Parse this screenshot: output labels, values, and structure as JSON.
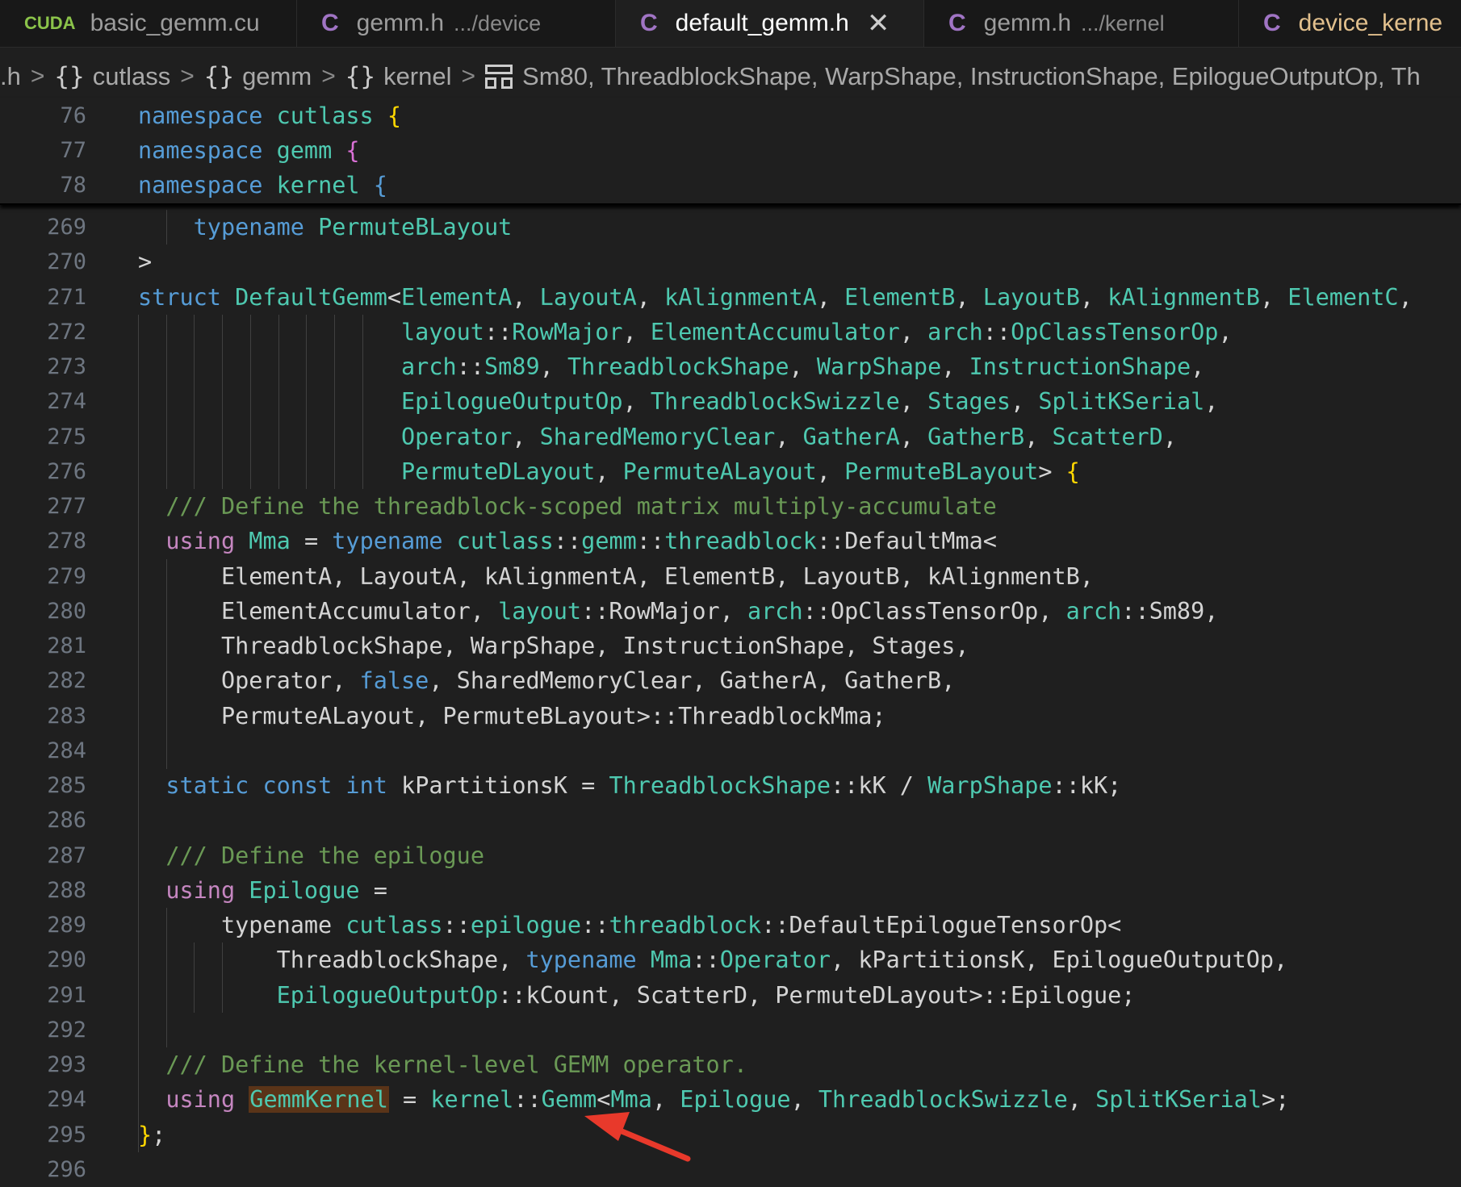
{
  "tabs": [
    {
      "name": "basic_gemm.cu",
      "icon": "cuda-file-icon",
      "icon_text": "CUDA",
      "desc": "",
      "active": false
    },
    {
      "name": "gemm.h",
      "icon": "c-file-icon",
      "icon_text": "C",
      "desc": ".../device",
      "active": false
    },
    {
      "name": "default_gemm.h",
      "icon": "c-file-icon",
      "icon_text": "C",
      "desc": "",
      "active": true
    },
    {
      "name": "gemm.h",
      "icon": "c-file-icon",
      "icon_text": "C",
      "desc": ".../kernel",
      "active": false
    },
    {
      "name": "device_kerne",
      "icon": "c-file-icon",
      "icon_text": "C",
      "desc": "",
      "active": false
    }
  ],
  "tab_close_glyph": "✕",
  "breadcrumb": {
    "items": [
      {
        "label": ".h",
        "icon": ""
      },
      {
        "label": "cutlass",
        "icon": "{}"
      },
      {
        "label": "gemm",
        "icon": "{}"
      },
      {
        "label": "kernel",
        "icon": "{}"
      },
      {
        "label": "Sm80, ThreadblockShape, WarpShape, InstructionShape, EpilogueOutputOp, Th",
        "icon": "struct"
      }
    ],
    "separator": ">"
  },
  "sticky_lines": [
    {
      "n": "76",
      "tokens": [
        [
          "k",
          "namespace"
        ],
        [
          "w",
          " "
        ],
        [
          "t",
          "cutlass"
        ],
        [
          "w",
          " "
        ],
        [
          "y",
          "{"
        ]
      ]
    },
    {
      "n": "77",
      "tokens": [
        [
          "k",
          "namespace"
        ],
        [
          "w",
          " "
        ],
        [
          "t",
          "gemm"
        ],
        [
          "w",
          " "
        ],
        [
          "pb",
          "{"
        ]
      ]
    },
    {
      "n": "78",
      "tokens": [
        [
          "k",
          "namespace"
        ],
        [
          "w",
          " "
        ],
        [
          "t",
          "kernel"
        ],
        [
          "w",
          " "
        ],
        [
          "k",
          "{"
        ]
      ]
    }
  ],
  "lines": [
    {
      "n": "269",
      "indent": "    ",
      "tokens": [
        [
          "k",
          "typename"
        ],
        [
          "w",
          " "
        ],
        [
          "t",
          "PermuteBLayout"
        ]
      ]
    },
    {
      "n": "270",
      "indent": "",
      "tokens": [
        [
          "w",
          ">"
        ]
      ]
    },
    {
      "n": "271",
      "indent": "",
      "tokens": [
        [
          "k",
          "struct"
        ],
        [
          "w",
          " "
        ],
        [
          "t",
          "DefaultGemm"
        ],
        [
          "w",
          "<"
        ],
        [
          "t",
          "ElementA"
        ],
        [
          "w",
          ", "
        ],
        [
          "t",
          "LayoutA"
        ],
        [
          "w",
          ", "
        ],
        [
          "t",
          "kAlignmentA"
        ],
        [
          "w",
          ", "
        ],
        [
          "t",
          "ElementB"
        ],
        [
          "w",
          ", "
        ],
        [
          "t",
          "LayoutB"
        ],
        [
          "w",
          ", "
        ],
        [
          "t",
          "kAlignmentB"
        ],
        [
          "w",
          ", "
        ],
        [
          "t",
          "ElementC"
        ],
        [
          "w",
          ","
        ]
      ]
    },
    {
      "n": "272",
      "indent": "                   ",
      "tokens": [
        [
          "t",
          "layout"
        ],
        [
          "w",
          "::"
        ],
        [
          "t",
          "RowMajor"
        ],
        [
          "w",
          ", "
        ],
        [
          "t",
          "ElementAccumulator"
        ],
        [
          "w",
          ", "
        ],
        [
          "t",
          "arch"
        ],
        [
          "w",
          "::"
        ],
        [
          "t",
          "OpClassTensorOp"
        ],
        [
          "w",
          ","
        ]
      ]
    },
    {
      "n": "273",
      "indent": "                   ",
      "tokens": [
        [
          "t",
          "arch"
        ],
        [
          "w",
          "::"
        ],
        [
          "t",
          "Sm89"
        ],
        [
          "w",
          ", "
        ],
        [
          "t",
          "ThreadblockShape"
        ],
        [
          "w",
          ", "
        ],
        [
          "t",
          "WarpShape"
        ],
        [
          "w",
          ", "
        ],
        [
          "t",
          "InstructionShape"
        ],
        [
          "w",
          ","
        ]
      ]
    },
    {
      "n": "274",
      "indent": "                   ",
      "tokens": [
        [
          "t",
          "EpilogueOutputOp"
        ],
        [
          "w",
          ", "
        ],
        [
          "t",
          "ThreadblockSwizzle"
        ],
        [
          "w",
          ", "
        ],
        [
          "t",
          "Stages"
        ],
        [
          "w",
          ", "
        ],
        [
          "t",
          "SplitKSerial"
        ],
        [
          "w",
          ","
        ]
      ]
    },
    {
      "n": "275",
      "indent": "                   ",
      "tokens": [
        [
          "t",
          "Operator"
        ],
        [
          "w",
          ", "
        ],
        [
          "t",
          "SharedMemoryClear"
        ],
        [
          "w",
          ", "
        ],
        [
          "t",
          "GatherA"
        ],
        [
          "w",
          ", "
        ],
        [
          "t",
          "GatherB"
        ],
        [
          "w",
          ", "
        ],
        [
          "t",
          "ScatterD"
        ],
        [
          "w",
          ","
        ]
      ]
    },
    {
      "n": "276",
      "indent": "                   ",
      "tokens": [
        [
          "t",
          "PermuteDLayout"
        ],
        [
          "w",
          ", "
        ],
        [
          "t",
          "PermuteALayout"
        ],
        [
          "w",
          ", "
        ],
        [
          "t",
          "PermuteBLayout"
        ],
        [
          "w",
          "> "
        ],
        [
          "y",
          "{"
        ]
      ]
    },
    {
      "n": "277",
      "indent": "  ",
      "tokens": [
        [
          "cm",
          "/// Define the threadblock-scoped matrix multiply-accumulate"
        ]
      ]
    },
    {
      "n": "278",
      "indent": "  ",
      "tokens": [
        [
          "p",
          "using"
        ],
        [
          "w",
          " "
        ],
        [
          "t",
          "Mma"
        ],
        [
          "w",
          " = "
        ],
        [
          "k",
          "typename"
        ],
        [
          "w",
          " "
        ],
        [
          "t",
          "cutlass"
        ],
        [
          "w",
          "::"
        ],
        [
          "t",
          "gemm"
        ],
        [
          "w",
          "::"
        ],
        [
          "t",
          "threadblock"
        ],
        [
          "w",
          "::DefaultMma<"
        ]
      ]
    },
    {
      "n": "279",
      "indent": "      ",
      "tokens": [
        [
          "w",
          "ElementA, LayoutA, kAlignmentA, ElementB, LayoutB, kAlignmentB,"
        ]
      ]
    },
    {
      "n": "280",
      "indent": "      ",
      "tokens": [
        [
          "w",
          "ElementAccumulator, "
        ],
        [
          "t",
          "layout"
        ],
        [
          "w",
          "::RowMajor, "
        ],
        [
          "t",
          "arch"
        ],
        [
          "w",
          "::OpClassTensorOp, "
        ],
        [
          "t",
          "arch"
        ],
        [
          "w",
          "::Sm89,"
        ]
      ]
    },
    {
      "n": "281",
      "indent": "      ",
      "tokens": [
        [
          "w",
          "ThreadblockShape, WarpShape, InstructionShape, Stages,"
        ]
      ]
    },
    {
      "n": "282",
      "indent": "      ",
      "tokens": [
        [
          "w",
          "Operator, "
        ],
        [
          "k",
          "false"
        ],
        [
          "w",
          ", SharedMemoryClear, GatherA, GatherB,"
        ]
      ]
    },
    {
      "n": "283",
      "indent": "      ",
      "tokens": [
        [
          "w",
          "PermuteALayout, PermuteBLayout>::ThreadblockMma;"
        ]
      ]
    },
    {
      "n": "284",
      "indent": "",
      "tokens": []
    },
    {
      "n": "285",
      "indent": "  ",
      "tokens": [
        [
          "k",
          "static"
        ],
        [
          "w",
          " "
        ],
        [
          "k",
          "const"
        ],
        [
          "w",
          " "
        ],
        [
          "k",
          "int"
        ],
        [
          "w",
          " kPartitionsK = "
        ],
        [
          "t",
          "ThreadblockShape"
        ],
        [
          "w",
          "::kK / "
        ],
        [
          "t",
          "WarpShape"
        ],
        [
          "w",
          "::kK;"
        ]
      ]
    },
    {
      "n": "286",
      "indent": "",
      "tokens": []
    },
    {
      "n": "287",
      "indent": "  ",
      "tokens": [
        [
          "cm",
          "/// Define the epilogue"
        ]
      ]
    },
    {
      "n": "288",
      "indent": "  ",
      "tokens": [
        [
          "p",
          "using"
        ],
        [
          "w",
          " "
        ],
        [
          "t",
          "Epilogue"
        ],
        [
          "w",
          " ="
        ]
      ]
    },
    {
      "n": "289",
      "indent": "      ",
      "tokens": [
        [
          "w",
          "typename "
        ],
        [
          "t",
          "cutlass"
        ],
        [
          "w",
          "::"
        ],
        [
          "t",
          "epilogue"
        ],
        [
          "w",
          "::"
        ],
        [
          "t",
          "threadblock"
        ],
        [
          "w",
          "::DefaultEpilogueTensorOp<"
        ]
      ]
    },
    {
      "n": "290",
      "indent": "          ",
      "tokens": [
        [
          "w",
          "ThreadblockShape, "
        ],
        [
          "k",
          "typename"
        ],
        [
          "w",
          " "
        ],
        [
          "t",
          "Mma"
        ],
        [
          "w",
          "::"
        ],
        [
          "t",
          "Operator"
        ],
        [
          "w",
          ", kPartitionsK, EpilogueOutputOp,"
        ]
      ]
    },
    {
      "n": "291",
      "indent": "          ",
      "tokens": [
        [
          "t",
          "EpilogueOutputOp"
        ],
        [
          "w",
          "::kCount, ScatterD, PermuteDLayout>::Epilogue;"
        ]
      ]
    },
    {
      "n": "292",
      "indent": "",
      "tokens": []
    },
    {
      "n": "293",
      "indent": "  ",
      "tokens": [
        [
          "cm",
          "/// Define the kernel-level GEMM operator."
        ]
      ]
    },
    {
      "n": "294",
      "indent": "  ",
      "tokens": [
        [
          "p",
          "using"
        ],
        [
          "w",
          " "
        ],
        [
          "hl",
          "GemmKernel"
        ],
        [
          "w",
          " = "
        ],
        [
          "t",
          "kernel"
        ],
        [
          "w",
          "::"
        ],
        [
          "t",
          "Gemm"
        ],
        [
          "w",
          "<"
        ],
        [
          "t",
          "Mma"
        ],
        [
          "w",
          ", "
        ],
        [
          "t",
          "Epilogue"
        ],
        [
          "w",
          ", "
        ],
        [
          "t",
          "ThreadblockSwizzle"
        ],
        [
          "w",
          ", "
        ],
        [
          "t",
          "SplitKSerial"
        ],
        [
          "w",
          ">;"
        ]
      ]
    },
    {
      "n": "295",
      "indent": "",
      "tokens": [
        [
          "y",
          "}"
        ],
        [
          "w",
          ";"
        ]
      ]
    },
    {
      "n": "296",
      "indent": "",
      "tokens": []
    }
  ],
  "annotation": {
    "icon": "red-arrow-icon",
    "color": "#e8392b"
  }
}
